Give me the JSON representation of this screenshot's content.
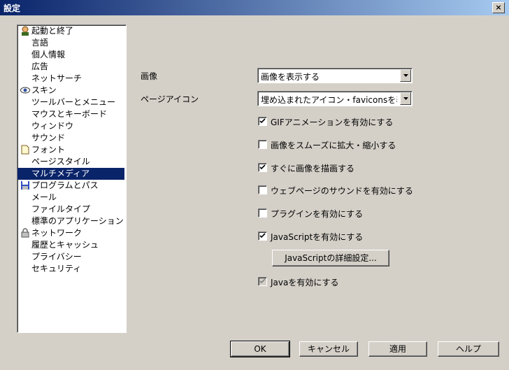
{
  "window": {
    "title": "設定",
    "close_label": "×"
  },
  "sidebar": {
    "items": [
      {
        "label": "起動と終了",
        "icon": "person-icon"
      },
      {
        "label": "言語"
      },
      {
        "label": "個人情報"
      },
      {
        "label": "広告"
      },
      {
        "label": "ネットサーチ"
      },
      {
        "label": "スキン",
        "icon": "eye-icon"
      },
      {
        "label": "ツールバーとメニュー"
      },
      {
        "label": "マウスとキーボード"
      },
      {
        "label": "ウィンドウ"
      },
      {
        "label": "サウンド"
      },
      {
        "label": "フォント",
        "icon": "document-icon"
      },
      {
        "label": "ページスタイル"
      },
      {
        "label": "マルチメディア",
        "selected": true
      },
      {
        "label": "プログラムとパス",
        "icon": "floppy-icon"
      },
      {
        "label": "メール"
      },
      {
        "label": "ファイルタイプ"
      },
      {
        "label": "標準のアプリケーション"
      },
      {
        "label": "ネットワーク",
        "icon": "lock-icon"
      },
      {
        "label": "履歴とキャッシュ"
      },
      {
        "label": "プライバシー"
      },
      {
        "label": "セキュリティ"
      }
    ]
  },
  "main": {
    "image_label": "画像",
    "image_value": "画像を表示する",
    "page_icon_label": "ページアイコン",
    "page_icon_value": "埋め込まれたアイコン・faviconsを表示",
    "checkboxes": [
      {
        "label": "GIFアニメーションを有効にする",
        "checked": true
      },
      {
        "label": "画像をスムーズに拡大・縮小する",
        "checked": false
      },
      {
        "label": "すぐに画像を描画する",
        "checked": true
      },
      {
        "label": "ウェブページのサウンドを有効にする",
        "checked": false
      },
      {
        "label": "プラグインを有効にする",
        "checked": false
      },
      {
        "label": "JavaScriptを有効にする",
        "checked": true
      }
    ],
    "js_advanced_button": "JavaScriptの詳細設定...",
    "java_checkbox": {
      "label": "Javaを有効にする",
      "checked": true,
      "disabled": true
    }
  },
  "footer": {
    "ok": "OK",
    "cancel": "キャンセル",
    "apply": "適用",
    "help": "ヘルプ"
  }
}
